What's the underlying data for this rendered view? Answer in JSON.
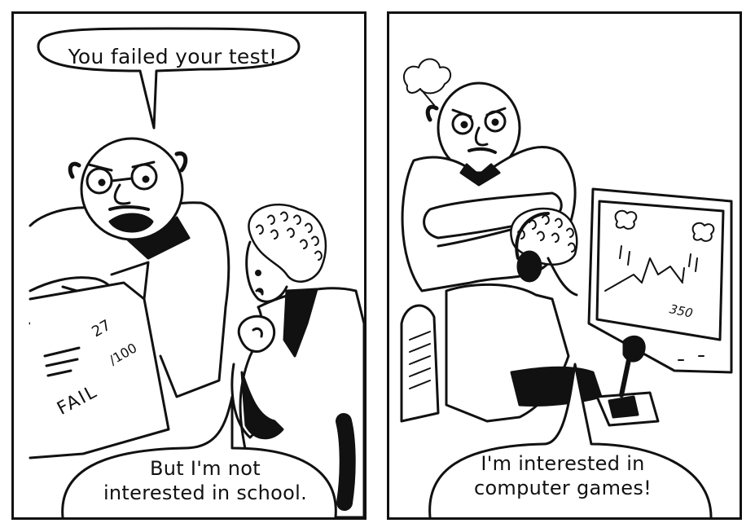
{
  "panels": {
    "left": {
      "speech_top": [
        "You failed your test!"
      ],
      "speech_bottom": [
        "But I'm not",
        "interested in school."
      ],
      "paper": {
        "score_numerator": "27",
        "score_denominator": "/100",
        "fail_label": "FAIL"
      }
    },
    "right": {
      "speech_bottom": [
        "I'm interested in",
        "computer games!"
      ],
      "game_score": "350"
    }
  },
  "colors": {
    "ink": "#111111",
    "paper": "#ffffff"
  }
}
